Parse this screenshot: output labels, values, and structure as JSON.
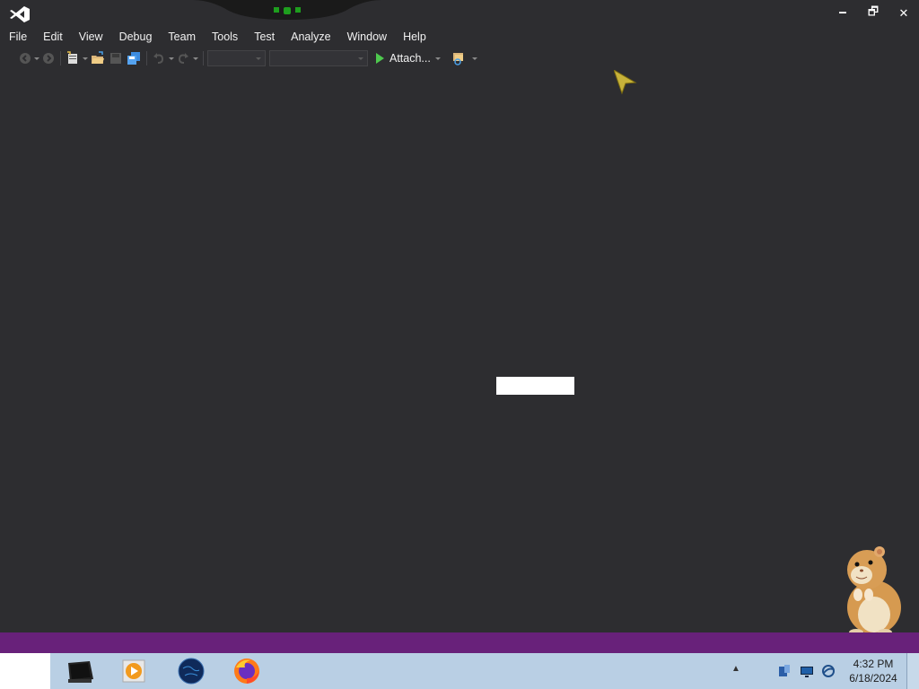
{
  "window": {
    "controls": {
      "minimize": "🗕",
      "restore": "🗗",
      "close": "✕"
    }
  },
  "menu": [
    "File",
    "Edit",
    "View",
    "Debug",
    "Team",
    "Tools",
    "Test",
    "Analyze",
    "Window",
    "Help"
  ],
  "toolbar": {
    "attach_label": "Attach...",
    "icons": [
      "back-icon",
      "forward-icon",
      "new-project-icon",
      "open-file-icon",
      "save-icon",
      "save-all-icon",
      "undo-icon",
      "redo-icon",
      "start-icon",
      "find-icon"
    ]
  },
  "colors": {
    "background": "#2d2d30",
    "status_bar": "#68217a",
    "taskbar": "#b9cfe4",
    "start_green": "#4ec94e",
    "accent_green": "#1e9e1e"
  },
  "taskbar": {
    "apps": [
      "terminal-icon",
      "media-player-icon",
      "globe-icon",
      "firefox-icon"
    ],
    "tray_arrow": "▲",
    "clock": {
      "time": "4:32 PM",
      "date": "6/18/2024"
    }
  }
}
